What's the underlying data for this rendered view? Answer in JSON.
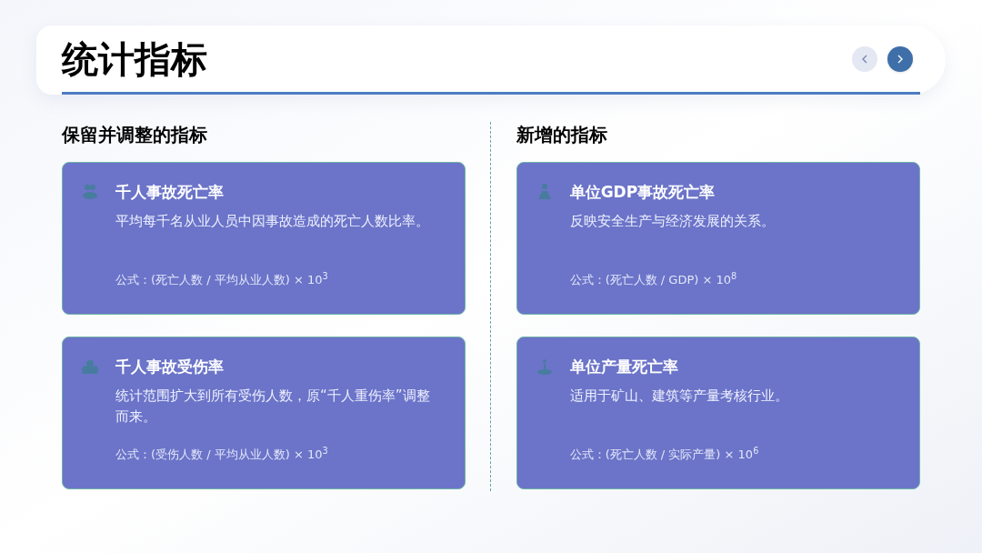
{
  "header": {
    "title": "统计指标"
  },
  "nav_buttons": [
    {
      "kind": "prev",
      "disabled": true
    },
    {
      "kind": "next",
      "disabled": false
    }
  ],
  "sections": [
    {
      "heading": "保留并调整的指标",
      "cards": [
        {
          "title": "千人事故死亡率",
          "description": "平均每千名从业人员中因事故造成的死亡人数比率。",
          "formula": "公式：(死亡人数 / 平均从业人数) × 10$^{3}$"
        },
        {
          "title": "千人事故受伤率",
          "description": "统计范围扩大到所有受伤人数，原“千人重伤率”调整而来。",
          "formula": "公式：(受伤人数 / 平均从业人数) × 10$^{3}$"
        }
      ]
    },
    {
      "heading": "新增的指标",
      "cards": [
        {
          "title": "单位GDP事故死亡率",
          "description": "反映安全生产与经济发展的关系。",
          "formula": "公式：(死亡人数 / GDP) × 10$^{8}$"
        },
        {
          "title": "单位产量死亡率",
          "description": "适用于矿山、建筑等产量考核行业。",
          "formula": "公式：(死亡人数 / 实际产量) × 10$^{6}$"
        }
      ]
    }
  ]
}
